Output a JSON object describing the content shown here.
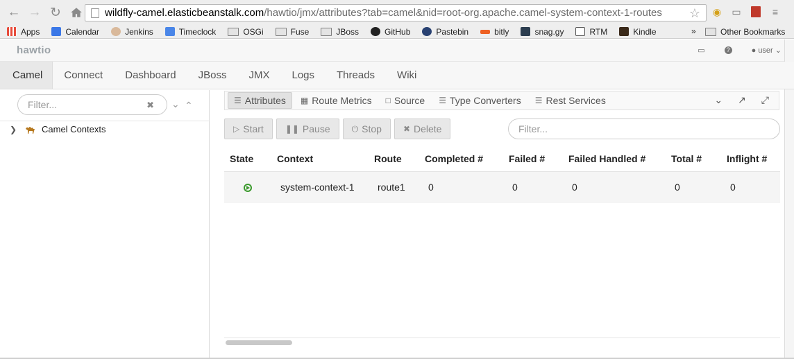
{
  "browser": {
    "url_host": "wildfly-camel.elasticbeanstalk.com",
    "url_path": "/hawtio/jmx/attributes?tab=camel&nid=root-org.apache.camel-system-context-1-routes"
  },
  "bookmarks": [
    {
      "label": "Apps",
      "icon": "apps-grid-icon"
    },
    {
      "label": "Calendar",
      "icon": "calendar-icon"
    },
    {
      "label": "Jenkins",
      "icon": "jenkins-icon"
    },
    {
      "label": "Timeclock",
      "icon": "google-icon"
    },
    {
      "label": "OSGi",
      "icon": "folder-icon"
    },
    {
      "label": "Fuse",
      "icon": "folder-icon"
    },
    {
      "label": "JBoss",
      "icon": "folder-icon"
    },
    {
      "label": "GitHub",
      "icon": "github-icon"
    },
    {
      "label": "Pastebin",
      "icon": "fedora-icon"
    },
    {
      "label": "bitly",
      "icon": "bitly-icon"
    },
    {
      "label": "snag.gy",
      "icon": "snaggy-icon"
    },
    {
      "label": "RTM",
      "icon": "rtm-icon"
    },
    {
      "label": "Kindle",
      "icon": "kindle-icon"
    }
  ],
  "bookmarks_overflow": "»",
  "other_bookmarks": "Other Bookmarks",
  "header": {
    "logo": "hawtio",
    "user": "user"
  },
  "main_nav": [
    "Camel",
    "Connect",
    "Dashboard",
    "JBoss",
    "JMX",
    "Logs",
    "Threads",
    "Wiki"
  ],
  "tree": {
    "filter_placeholder": "Filter...",
    "root_label": "Camel Contexts"
  },
  "sub_tabs": [
    {
      "label": "Attributes",
      "icon": "list-icon"
    },
    {
      "label": "Route Metrics",
      "icon": "bar-chart-icon"
    },
    {
      "label": "Source",
      "icon": "file-icon"
    },
    {
      "label": "Type Converters",
      "icon": "list-icon"
    },
    {
      "label": "Rest Services",
      "icon": "list-icon"
    }
  ],
  "actions": {
    "start": "Start",
    "pause": "Pause",
    "stop": "Stop",
    "delete": "Delete"
  },
  "table": {
    "filter_placeholder": "Filter...",
    "columns": [
      "State",
      "Context",
      "Route",
      "Completed #",
      "Failed #",
      "Failed Handled #",
      "Total #",
      "Inflight #"
    ],
    "rows": [
      {
        "state": "started",
        "context": "system-context-1",
        "route": "route1",
        "completed": "0",
        "failed": "0",
        "failed_handled": "0",
        "total": "0",
        "inflight": "0"
      }
    ]
  }
}
